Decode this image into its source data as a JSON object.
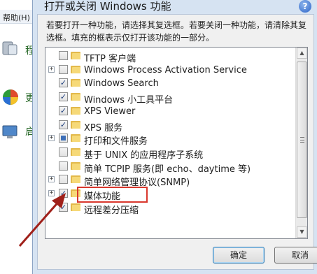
{
  "background_window": {
    "menu_label": "帮助(H)",
    "fragments": [
      "程",
      "更",
      "启"
    ]
  },
  "dialog": {
    "title": "打开或关闭 Windows 功能",
    "help": "?",
    "description": "若要打开一种功能，请选择其复选框。若要关闭一种功能，请清除其复选框。填充的框表示仅打开该功能的一部分。"
  },
  "features": [
    {
      "label": "TFTP 客户端",
      "expandable": false,
      "state": "unchecked"
    },
    {
      "label": "Windows Process Activation Service",
      "expandable": true,
      "state": "unchecked"
    },
    {
      "label": "Windows Search",
      "expandable": false,
      "state": "checked"
    },
    {
      "label": "Windows 小工具平台",
      "expandable": false,
      "state": "checked"
    },
    {
      "label": "XPS Viewer",
      "expandable": false,
      "state": "checked"
    },
    {
      "label": "XPS 服务",
      "expandable": false,
      "state": "checked"
    },
    {
      "label": "打印和文件服务",
      "expandable": true,
      "state": "partial"
    },
    {
      "label": "基于 UNIX 的应用程序子系统",
      "expandable": false,
      "state": "unchecked"
    },
    {
      "label": "简单 TCPIP 服务(即 echo、daytime 等)",
      "expandable": false,
      "state": "unchecked"
    },
    {
      "label": "简单网络管理协议(SNMP)",
      "expandable": true,
      "state": "unchecked"
    },
    {
      "label": "媒体功能",
      "expandable": true,
      "state": "checked"
    },
    {
      "label": "远程差分压缩",
      "expandable": false,
      "state": "checked"
    }
  ],
  "buttons": {
    "ok": "确定",
    "cancel": "取消"
  },
  "icons": {
    "expander": "+",
    "check": "✓",
    "scroll_up": "▲",
    "scroll_down": "▼"
  },
  "colors": {
    "highlight": "#d9382d",
    "arrow": "#a0201a",
    "folder": "#f6d978"
  }
}
